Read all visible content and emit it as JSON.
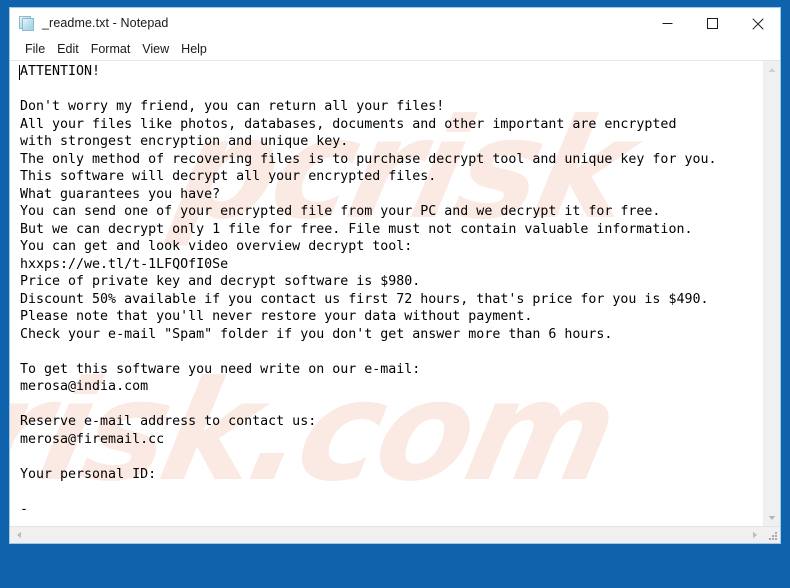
{
  "window": {
    "title": "_readme.txt - Notepad",
    "app_icon": "notepad-icon",
    "controls": {
      "minimize": "minimize-icon",
      "maximize": "maximize-icon",
      "close": "close-icon"
    }
  },
  "menu": {
    "items": [
      {
        "label": "File"
      },
      {
        "label": "Edit"
      },
      {
        "label": "Format"
      },
      {
        "label": "View"
      },
      {
        "label": "Help"
      }
    ]
  },
  "editor": {
    "content": "ATTENTION!\n\nDon't worry my friend, you can return all your files!\nAll your files like photos, databases, documents and other important are encrypted\nwith strongest encryption and unique key.\nThe only method of recovering files is to purchase decrypt tool and unique key for you.\nThis software will decrypt all your encrypted files.\nWhat guarantees you have?\nYou can send one of your encrypted file from your PC and we decrypt it for free.\nBut we can decrypt only 1 file for free. File must not contain valuable information.\nYou can get and look video overview decrypt tool:\nhxxps://we.tl/t-1LFQOfI0Se\nPrice of private key and decrypt software is $980.\nDiscount 50% available if you contact us first 72 hours, that's price for you is $490.\nPlease note that you'll never restore your data without payment.\nCheck your e-mail \"Spam\" folder if you don't get answer more than 6 hours.\n\nTo get this software you need write on our e-mail:\nmerosa@india.com\n\nReserve e-mail address to contact us:\nmerosa@firemail.cc\n\nYour personal ID:\n\n-",
    "ransom_details": {
      "price_full": "$980",
      "price_discounted": "$490",
      "discount_percent": "50%",
      "discount_window_hours": "72 hours",
      "answer_wait_hours": "6 hours",
      "video_url": "hxxps://we.tl/t-1LFQOfI0Se",
      "primary_email": "merosa@india.com",
      "reserve_email": "merosa@firemail.cc",
      "personal_id": "-"
    }
  },
  "watermark": {
    "line_a": "pcrisk",
    "line_b": "risk.com"
  },
  "scrollbars": {
    "vertical_up": "scroll-up-icon",
    "vertical_down": "scroll-down-icon",
    "horizontal_left": "scroll-left-icon",
    "horizontal_right": "scroll-right-icon",
    "resize_grip": "resize-grip-icon"
  },
  "colors": {
    "desktop": "#0F62AC",
    "window_bg": "#ffffff",
    "text": "#000000",
    "scrollbar_bg": "#f0f0f0",
    "watermark": "#f6d9cd"
  }
}
